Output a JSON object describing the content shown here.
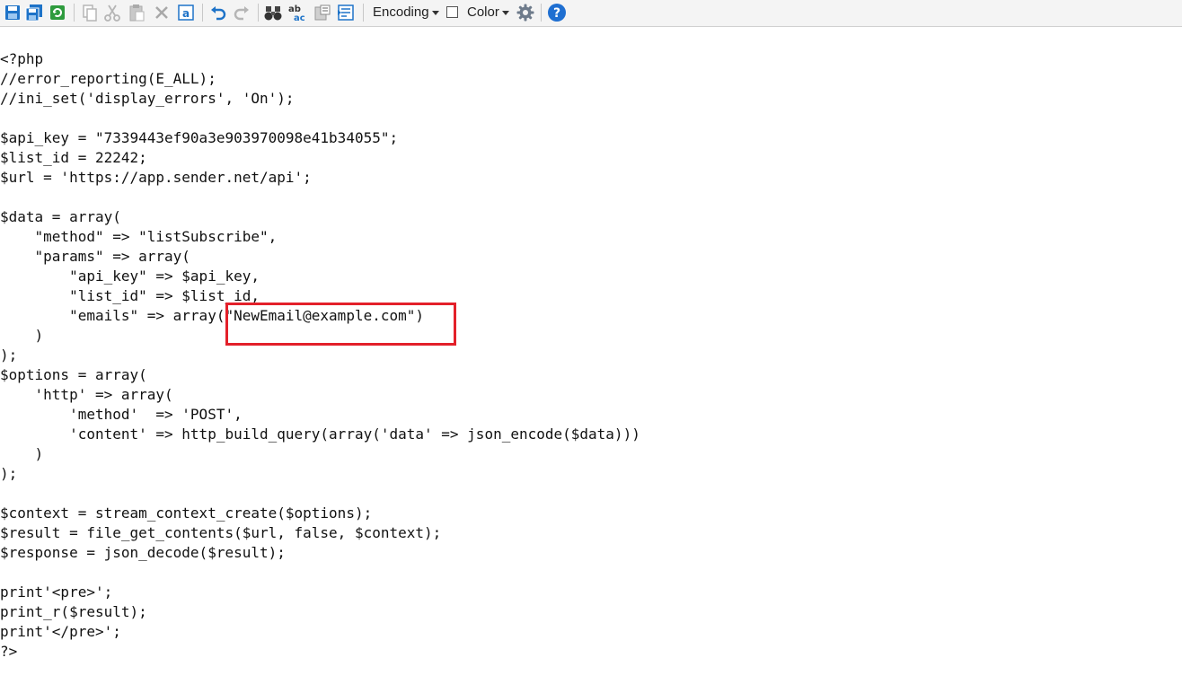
{
  "toolbar": {
    "buttons": [
      {
        "name": "save-icon"
      },
      {
        "name": "save-all-icon"
      },
      {
        "name": "reload-icon"
      },
      {
        "name": "copy-icon"
      },
      {
        "name": "cut-icon"
      },
      {
        "name": "paste-icon"
      },
      {
        "name": "delete-icon"
      },
      {
        "name": "select-all-icon"
      },
      {
        "name": "undo-icon"
      },
      {
        "name": "redo-icon"
      },
      {
        "name": "find-icon"
      },
      {
        "name": "spell-check-icon"
      },
      {
        "name": "replace-icon"
      },
      {
        "name": "word-wrap-icon"
      },
      {
        "name": "settings-icon"
      },
      {
        "name": "help-icon"
      }
    ],
    "encoding_label": "Encoding",
    "color_label": "Color",
    "color_checked": false,
    "colors": {
      "icon_blue": "#1e73c8",
      "icon_green": "#2e9b3e",
      "disabled_gray": "#b5b5b5",
      "help_blue": "#1f6fd1"
    }
  },
  "editor": {
    "code_lines": [
      "<?php",
      "//error_reporting(E_ALL);",
      "//ini_set('display_errors', 'On');",
      "",
      "$api_key = \"7339443ef90a3e903970098e41b34055\";",
      "$list_id = 22242;",
      "$url = 'https://app.sender.net/api';",
      "",
      "$data = array(",
      "    \"method\" => \"listSubscribe\",",
      "    \"params\" => array(",
      "        \"api_key\" => $api_key,",
      "        \"list_id\" => $list_id,",
      "        \"emails\" => array(\"NewEmail@example.com\")",
      "    )",
      ");",
      "$options = array(",
      "    'http' => array(",
      "        'method'  => 'POST',",
      "        'content' => http_build_query(array('data' => json_encode($data)))",
      "    )",
      ");",
      "",
      "$context = stream_context_create($options);",
      "$result = file_get_contents($url, false, $context);",
      "$response = json_decode($result);",
      "",
      "print'<pre>';",
      "print_r($result);",
      "print'</pre>';",
      "?>"
    ],
    "highlight_color": "#e3202a"
  }
}
